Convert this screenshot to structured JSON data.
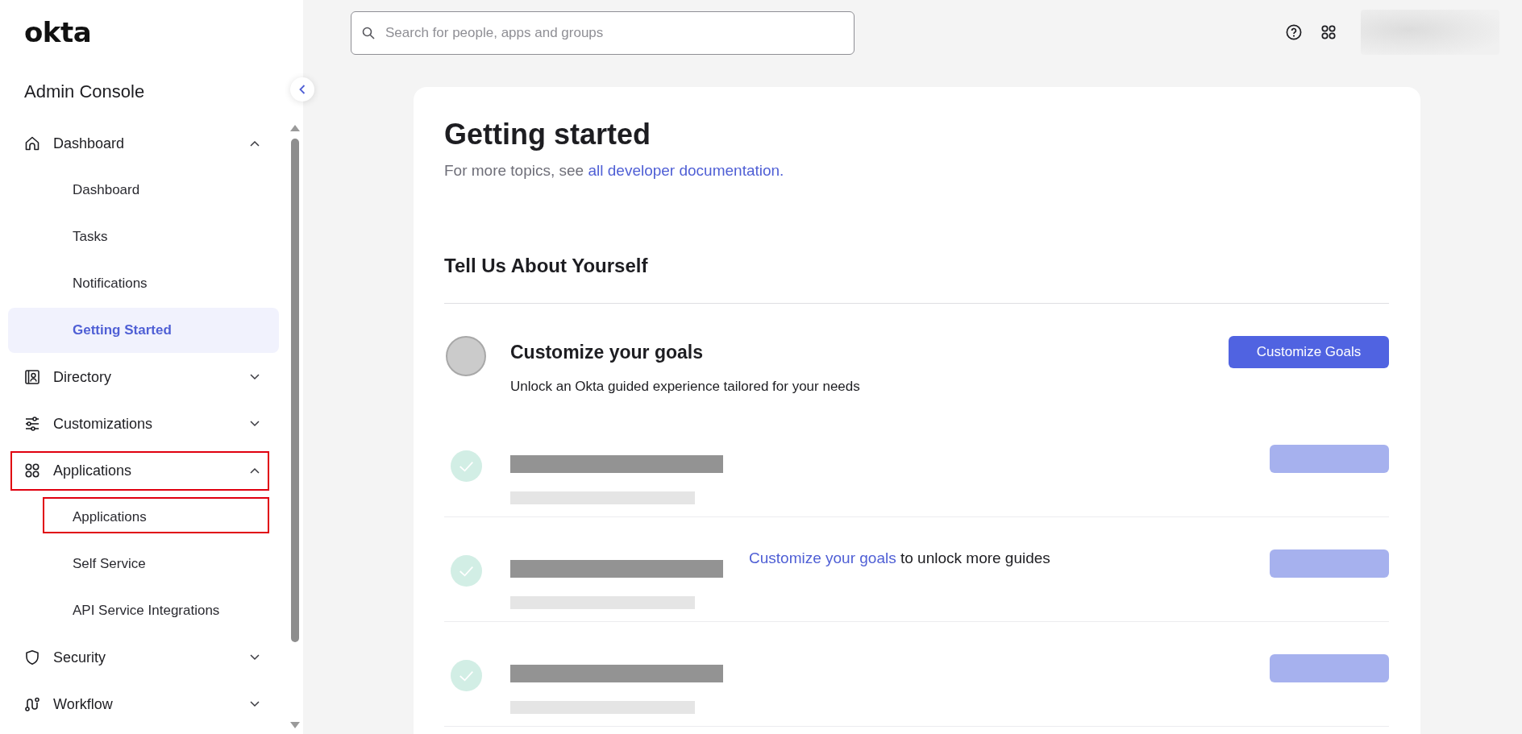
{
  "sidebar": {
    "logo": "okta",
    "title": "Admin Console",
    "nav": [
      {
        "label": "Dashboard",
        "expanded": true,
        "selected": false,
        "highlighted": false,
        "children": [
          {
            "label": "Dashboard",
            "selected": false,
            "highlighted": false
          },
          {
            "label": "Tasks",
            "selected": false,
            "highlighted": false
          },
          {
            "label": "Notifications",
            "selected": false,
            "highlighted": false
          },
          {
            "label": "Getting Started",
            "selected": true,
            "highlighted": false
          }
        ]
      },
      {
        "label": "Directory",
        "expanded": false,
        "selected": false,
        "highlighted": false
      },
      {
        "label": "Customizations",
        "expanded": false,
        "selected": false,
        "highlighted": false
      },
      {
        "label": "Applications",
        "expanded": true,
        "selected": false,
        "highlighted": true,
        "children": [
          {
            "label": "Applications",
            "selected": false,
            "highlighted": true
          },
          {
            "label": "Self Service",
            "selected": false,
            "highlighted": false
          },
          {
            "label": "API Service Integrations",
            "selected": false,
            "highlighted": false
          }
        ]
      },
      {
        "label": "Security",
        "expanded": false,
        "selected": false,
        "highlighted": false
      },
      {
        "label": "Workflow",
        "expanded": false,
        "selected": false,
        "highlighted": false
      }
    ]
  },
  "topbar": {
    "search": {
      "placeholder": "Search for people, apps and groups"
    }
  },
  "page": {
    "title": "Getting started",
    "subtitle": {
      "text": "For more topics, see ",
      "link": "all developer documentation."
    },
    "section_title": "Tell Us About Yourself",
    "goal": {
      "title": "Customize your goals",
      "description": "Unlock an Okta guided experience tailored for your needs",
      "button": "Customize Goals",
      "completed": false
    },
    "locked_guides": [
      {
        "checked": true
      },
      {
        "checked": true,
        "message": {
          "link": "Customize your goals",
          "text": " to unlock more guides"
        }
      },
      {
        "checked": true
      }
    ]
  }
}
